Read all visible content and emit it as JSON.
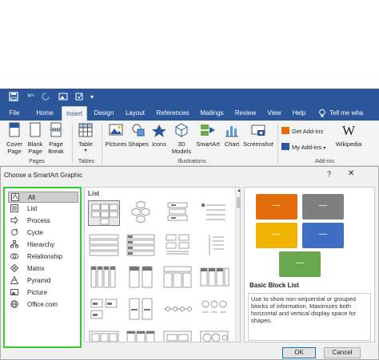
{
  "quickaccess": {
    "save_icon": "save-icon",
    "undo_icon": "undo-icon",
    "redo_icon": "redo-icon",
    "picture_icon": "insert-picture-icon",
    "customize_icon": "customize-quick-access-icon"
  },
  "tabs": [
    "File",
    "Home",
    "Insert",
    "Design",
    "Layout",
    "References",
    "Mailings",
    "Review",
    "View",
    "Help"
  ],
  "tell_me": "Tell me wha",
  "ribbon": {
    "pages": {
      "cover_page": "Cover Page",
      "cover_page_l1": "Cover",
      "cover_page_l2": "Page",
      "blank_page_l1": "Blank",
      "blank_page_l2": "Page",
      "page_break_l1": "Page",
      "page_break_l2": "Break",
      "group": "Pages"
    },
    "tables": {
      "table": "Table",
      "group": "Tables"
    },
    "illustrations": {
      "pictures": "Pictures",
      "shapes": "Shapes",
      "icons": "Icons",
      "models_l1": "3D",
      "models_l2": "Models",
      "smartart": "SmartArt",
      "chart": "Chart",
      "screenshot": "Screenshot",
      "group": "Illustrations"
    },
    "addins": {
      "get_addins": "Get Add-ins",
      "my_addins": "My Add-ins",
      "wikipedia": "Wikipedia",
      "group": "Add-ins"
    }
  },
  "dialog": {
    "title": "Choose a SmartArt Graphic",
    "help": "?",
    "close": "✕",
    "categories": [
      "All",
      "List",
      "Process",
      "Cycle",
      "Hierarchy",
      "Relationship",
      "Matrix",
      "Pyramid",
      "Picture",
      "Office.com"
    ],
    "gallery_title": "List",
    "preview_name": "Basic Block List",
    "preview_desc": "Use to show non-sequential or grouped blocks of information. Maximizes both horizontal and vertical display space for shapes.",
    "block_text": "—",
    "ok": "OK",
    "cancel": "Cancel",
    "colors": {
      "orange": "#e46c0a",
      "gray": "#7f7f7f",
      "yellow": "#f0b400",
      "blue": "#3f6fc4",
      "green": "#6aa84f",
      "accent": "#2b579a",
      "selection_outline": "#33cc33"
    }
  }
}
